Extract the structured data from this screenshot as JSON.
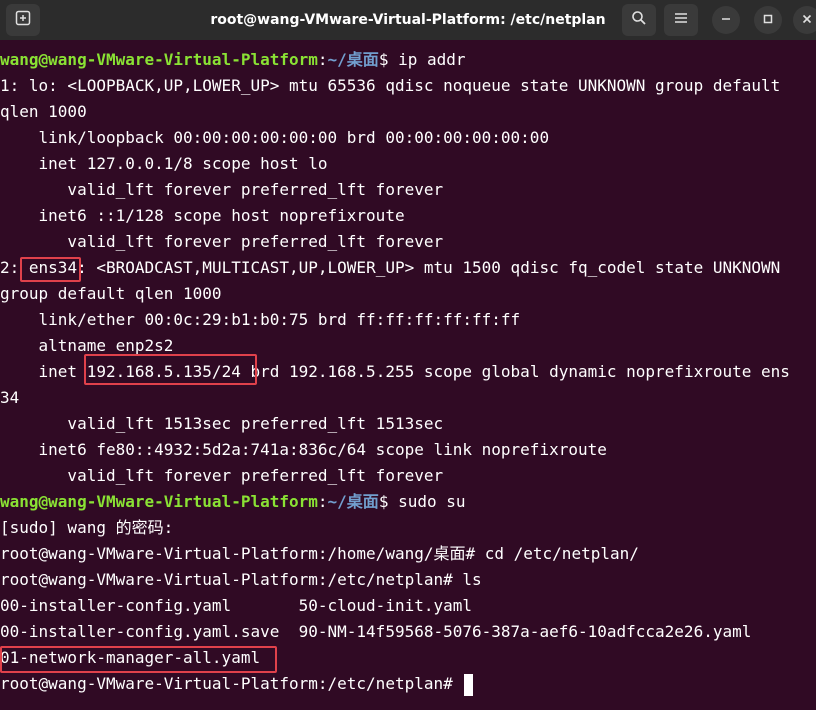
{
  "window": {
    "title": "root@wang-VMware-Virtual-Platform: /etc/netplan"
  },
  "titlebar": {
    "new_tab_icon": "new-tab-icon",
    "search_icon": "search-icon",
    "menu_icon": "hamburger-menu-icon",
    "minimize_icon": "minimize-icon",
    "maximize_icon": "maximize-icon",
    "close_icon": "close-icon"
  },
  "colors": {
    "background": "#300a24",
    "prompt_user": "#8ae234",
    "prompt_path": "#729fcf",
    "text": "#ffffff",
    "highlight_box": "#e0414b"
  },
  "terminal": {
    "prompt1_user": "wang@wang-VMware-Virtual-Platform",
    "prompt1_colon": ":",
    "prompt1_path": "~/桌面",
    "prompt1_rest": "$ ip addr",
    "l2": "1: lo: <LOOPBACK,UP,LOWER_UP> mtu 65536 qdisc noqueue state UNKNOWN group default",
    "l3": "qlen 1000",
    "l4": "    link/loopback 00:00:00:00:00:00 brd 00:00:00:00:00:00",
    "l5": "    inet 127.0.0.1/8 scope host lo",
    "l6": "       valid_lft forever preferred_lft forever",
    "l7": "    inet6 ::1/128 scope host noprefixroute",
    "l8": "       valid_lft forever preferred_lft forever",
    "l9_pre": "2: ",
    "l9_iface": "ens34",
    "l9_post": ": <BROADCAST,MULTICAST,UP,LOWER_UP> mtu 1500 qdisc fq_codel state UNKNOWN",
    "l10": "group default qlen 1000",
    "l11": "    link/ether 00:0c:29:b1:b0:75 brd ff:ff:ff:ff:ff:ff",
    "l12": "    altname enp2s2",
    "l13_pre": "    inet ",
    "l13_ip": "192.168.5.135/24",
    "l13_post": " brd 192.168.5.255 scope global dynamic noprefixroute ens",
    "l14": "34",
    "l15": "       valid_lft 1513sec preferred_lft 1513sec",
    "l16": "    inet6 fe80::4932:5d2a:741a:836c/64 scope link noprefixroute",
    "l17": "       valid_lft forever preferred_lft forever",
    "prompt2_user": "wang@wang-VMware-Virtual-Platform",
    "prompt2_colon": ":",
    "prompt2_path": "~/桌面",
    "prompt2_rest": "$ sudo su",
    "l19": "[sudo] wang 的密码:",
    "l20": "root@wang-VMware-Virtual-Platform:/home/wang/桌面# cd /etc/netplan/",
    "l21": "root@wang-VMware-Virtual-Platform:/etc/netplan# ls",
    "l22": "00-installer-config.yaml       50-cloud-init.yaml",
    "l23": "00-installer-config.yaml.save  90-NM-14f59568-5076-387a-aef6-10adfcca2e26.yaml",
    "l24": "01-network-manager-all.yaml",
    "l25": "root@wang-VMware-Virtual-Platform:/etc/netplan# "
  }
}
